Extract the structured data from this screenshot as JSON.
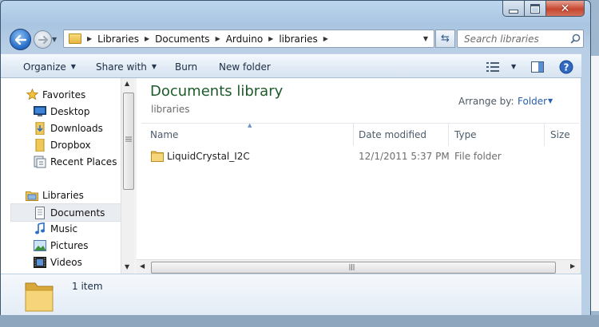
{
  "nav": {
    "back_label": "Back",
    "forward_label": "Forward"
  },
  "address": {
    "crumbs": [
      "Libraries",
      "Documents",
      "Arduino",
      "libraries"
    ]
  },
  "search": {
    "placeholder": "Search libraries"
  },
  "toolbar": {
    "organize": "Organize",
    "share_with": "Share with",
    "burn": "Burn",
    "new_folder": "New folder"
  },
  "sidebar": {
    "favorites_header": "Favorites",
    "favorites": [
      "Desktop",
      "Downloads",
      "Dropbox",
      "Recent Places"
    ],
    "libraries_header": "Libraries",
    "libraries": [
      "Documents",
      "Music",
      "Pictures",
      "Videos"
    ],
    "selected": "Documents"
  },
  "main": {
    "title": "Documents library",
    "subtitle": "libraries",
    "arrange_label": "Arrange by:",
    "arrange_value": "Folder",
    "columns": [
      "Name",
      "Date modified",
      "Type",
      "Size"
    ],
    "rows": [
      {
        "name": "LiquidCrystal_I2C",
        "date": "12/1/2011 5:37 PM",
        "type": "File folder",
        "size": ""
      }
    ]
  },
  "details": {
    "count": "1 item"
  },
  "colors": {
    "title_green": "#1e5a2a",
    "link_blue": "#2a5fb0",
    "close_red": "#c7462f"
  }
}
